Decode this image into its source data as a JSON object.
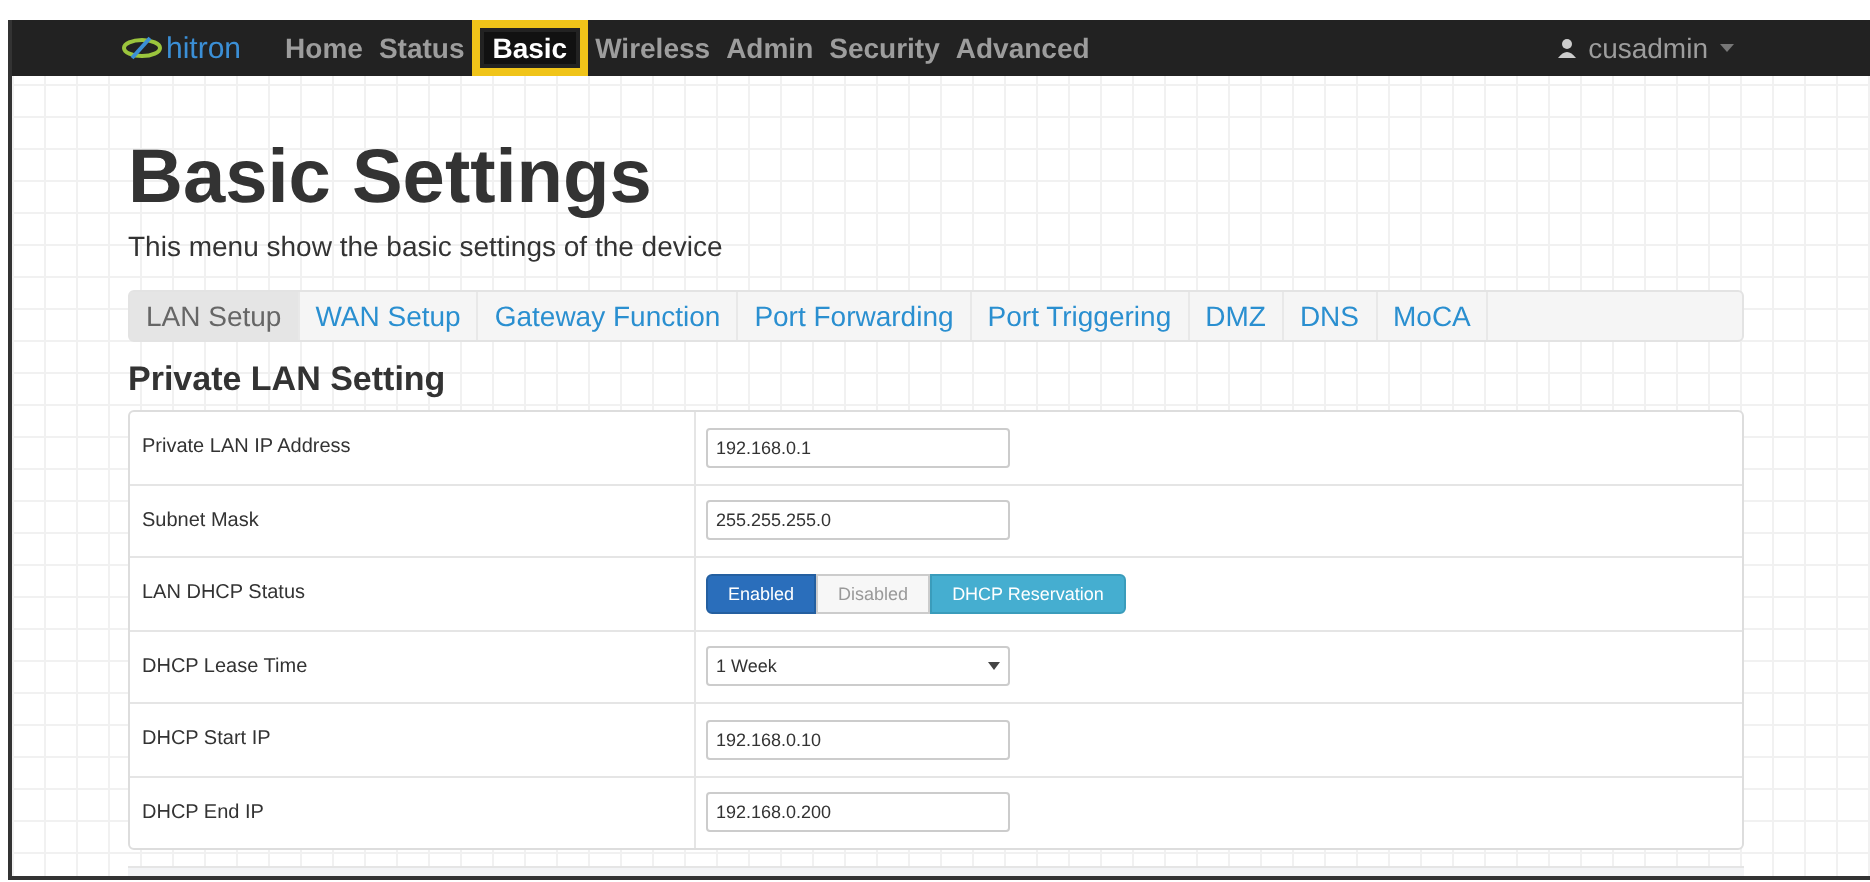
{
  "navbar": {
    "logo": "hitron",
    "items": [
      {
        "label": "Home",
        "selected": false
      },
      {
        "label": "Status",
        "selected": false
      },
      {
        "label": "Basic",
        "selected": true
      },
      {
        "label": "Wireless",
        "selected": false
      },
      {
        "label": "Admin",
        "selected": false
      },
      {
        "label": "Security",
        "selected": false
      },
      {
        "label": "Advanced",
        "selected": false
      }
    ],
    "user": "cusadmin"
  },
  "page": {
    "title": "Basic Settings",
    "subtitle": "This menu show the basic settings of the device"
  },
  "tabs": [
    {
      "label": "LAN Setup",
      "selected": true
    },
    {
      "label": "WAN Setup",
      "selected": false
    },
    {
      "label": "Gateway Function",
      "selected": false
    },
    {
      "label": "Port Forwarding",
      "selected": false
    },
    {
      "label": "Port Triggering",
      "selected": false
    },
    {
      "label": "DMZ",
      "selected": false
    },
    {
      "label": "DNS",
      "selected": false
    },
    {
      "label": "MoCA",
      "selected": false
    }
  ],
  "section": {
    "title": "Private LAN Setting",
    "rows": [
      {
        "label": "Private LAN IP Address",
        "kind": "input",
        "value": "192.168.0.1"
      },
      {
        "label": "Subnet Mask",
        "kind": "input",
        "value": "255.255.255.0"
      },
      {
        "label": "LAN DHCP Status",
        "kind": "buttons",
        "options": [
          {
            "label": "Enabled",
            "kind": "toggle",
            "selected": true
          },
          {
            "label": "Disabled",
            "kind": "toggle",
            "selected": false
          },
          {
            "label": "DHCP Reservation",
            "kind": "action"
          }
        ]
      },
      {
        "label": "DHCP Lease Time",
        "kind": "select",
        "value": "1 Week"
      },
      {
        "label": "DHCP Start IP",
        "kind": "input",
        "value": "192.168.0.10"
      },
      {
        "label": "DHCP End IP",
        "kind": "input",
        "value": "192.168.0.200"
      }
    ]
  }
}
